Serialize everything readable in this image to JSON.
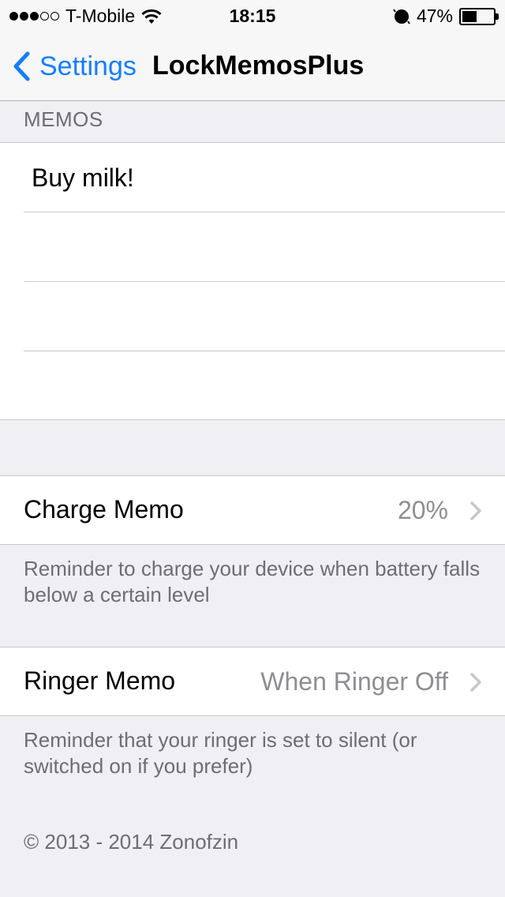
{
  "status_bar": {
    "signal_filled": 3,
    "signal_total": 5,
    "carrier": "T-Mobile",
    "time": "18:15",
    "battery_percent": "47%",
    "battery_level": 0.47
  },
  "nav": {
    "back_label": "Settings",
    "title": "LockMemosPlus"
  },
  "memos": {
    "header": "MEMOS",
    "items": [
      "Buy milk!",
      "",
      "",
      ""
    ]
  },
  "charge_memo": {
    "label": "Charge Memo",
    "value": "20%",
    "footer": "Reminder to charge your device when battery falls below a certain level"
  },
  "ringer_memo": {
    "label": "Ringer Memo",
    "value": "When Ringer Off",
    "footer": "Reminder that your ringer is set to silent (or switched on if you prefer)"
  },
  "copyright": "© 2013 - 2014 Zonofzin",
  "colors": {
    "accent": "#157efb",
    "background": "#efeff4",
    "secondary_text": "#8e8e93",
    "footer_text": "#6d6d72"
  }
}
